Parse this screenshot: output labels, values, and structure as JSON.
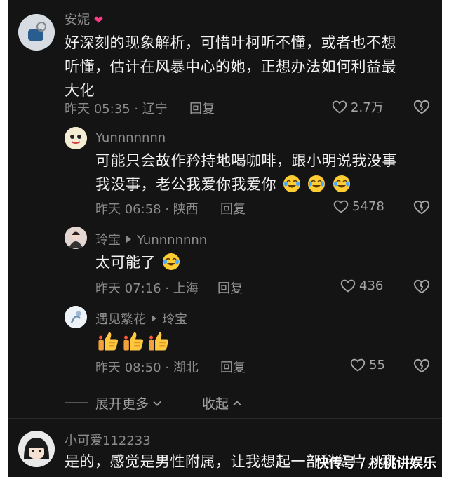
{
  "comments": [
    {
      "user": "安妮",
      "text": "好深刻的现象解析，可惜叶柯听不懂，或者也不想听懂，估计在风暴中心的她，正想办法如何利益最大化",
      "lines": [
        "好深刻的现象解析，可惜叶柯听不懂，或者也不想",
        "听懂，估计在风暴中心的她，正想办法如何利益最",
        "大化"
      ],
      "meta": "昨天 05:35 · 辽宁",
      "reply": "回复",
      "likes": "2.7万"
    },
    {
      "user": "Yunnnnnnn",
      "lines": [
        "可能只会故作矜持地喝咖啡，跟小明说我没事",
        "我没事，老公我爱你我爱你"
      ],
      "meta": "昨天 06:58 · 陕西",
      "reply": "回复",
      "likes": "5478"
    },
    {
      "user": "玲宝",
      "reply_to": "Yunnnnnnn",
      "lines": [
        "太可能了"
      ],
      "meta": "昨天 07:16 · 上海",
      "reply": "回复",
      "likes": "436"
    },
    {
      "user": "遇见繁花",
      "reply_to": "玲宝",
      "meta": "昨天 08:50 · 湖北",
      "reply": "回复",
      "likes": "55"
    },
    {
      "user": "小可爱112233",
      "lines": [
        "是的，感觉是男性附属，让我想起一部科幻片，妻"
      ]
    }
  ],
  "controls": {
    "expand_more": "展开更多",
    "collapse": "收起"
  },
  "watermark": "快传号 / 桃桃讲娱乐",
  "colors": {
    "background": "#141414",
    "text": "#f2f2f2",
    "meta": "#8c8c8c",
    "heart_pink": "#ff3b86"
  },
  "icons": [
    "heart-outline-icon",
    "broken-heart-icon",
    "chevron-down-icon",
    "chevron-up-icon",
    "face-tears-of-joy-emoji",
    "thumbs-up-emoji",
    "pink-heart-emoji"
  ]
}
